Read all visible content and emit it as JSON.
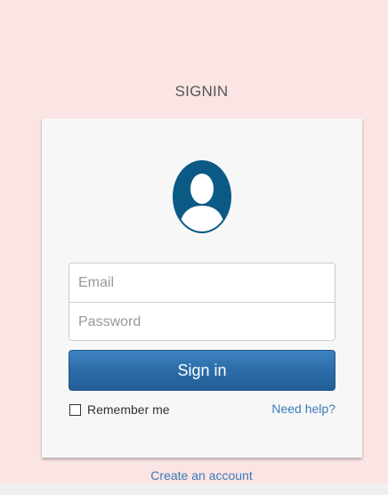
{
  "page": {
    "heading": "SIGNIN"
  },
  "form": {
    "email_placeholder": "Email",
    "password_placeholder": "Password",
    "signin_label": "Sign in",
    "remember_label": "Remember me",
    "remember_checked": false,
    "help_link": "Need help?"
  },
  "footer": {
    "create_account_link": "Create an account"
  },
  "icons": {
    "avatar": "user-avatar-icon"
  },
  "colors": {
    "background": "#fbe4e4",
    "card": "#f7f7f7",
    "avatar": "#0b5a85",
    "button": "#2a6aa6",
    "link": "#3a7bb8"
  }
}
